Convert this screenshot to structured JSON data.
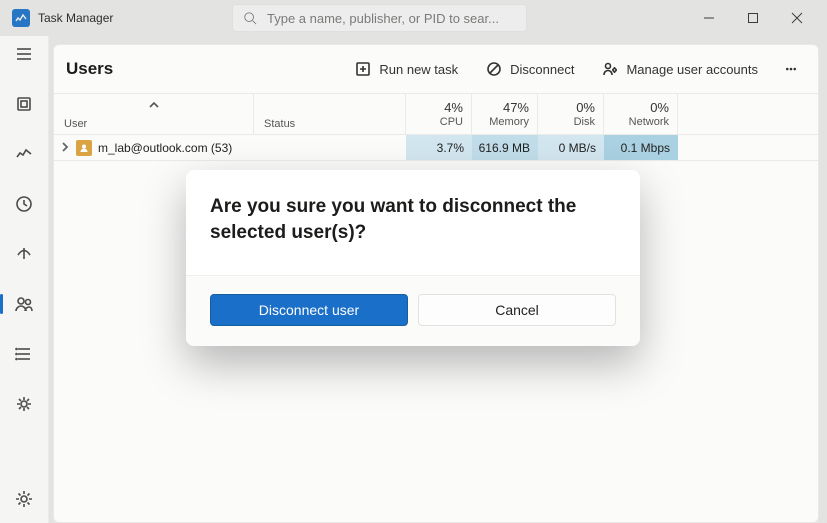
{
  "app": {
    "title": "Task Manager"
  },
  "search": {
    "placeholder": "Type a name, publisher, or PID to sear..."
  },
  "page": {
    "title": "Users"
  },
  "toolbar": {
    "run_new_task": "Run new task",
    "disconnect": "Disconnect",
    "manage_accounts": "Manage user accounts"
  },
  "columns": {
    "name": "User",
    "status": "Status",
    "cpu": {
      "pct": "4%",
      "label": "CPU"
    },
    "memory": {
      "pct": "47%",
      "label": "Memory"
    },
    "disk": {
      "pct": "0%",
      "label": "Disk"
    },
    "network": {
      "pct": "0%",
      "label": "Network"
    }
  },
  "rows": [
    {
      "name": "m_lab@outlook.com (53)",
      "cpu": "3.7%",
      "memory": "616.9 MB",
      "disk": "0 MB/s",
      "network": "0.1 Mbps"
    }
  ],
  "dialog": {
    "title": "Are you sure you want to disconnect the selected user(s)?",
    "primary": "Disconnect user",
    "secondary": "Cancel"
  }
}
